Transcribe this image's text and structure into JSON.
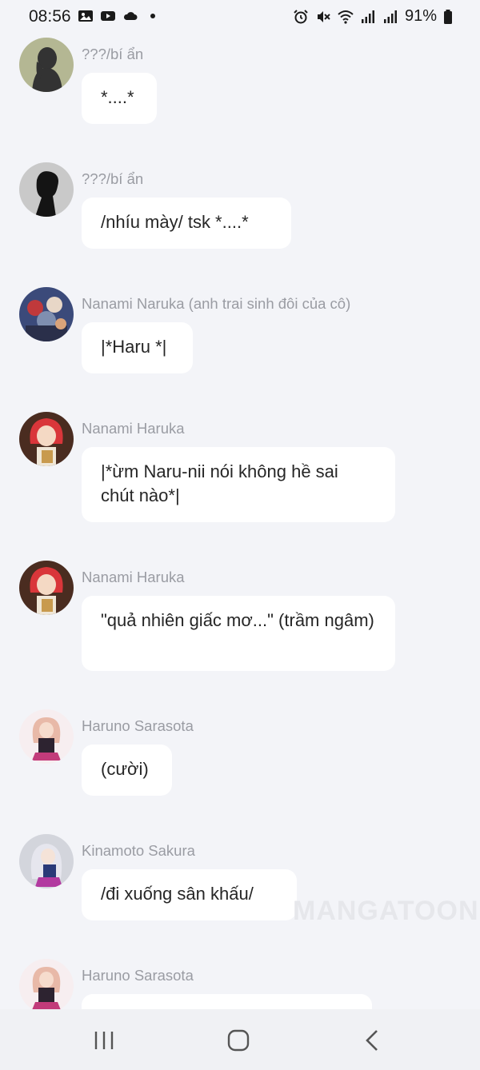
{
  "status_bar": {
    "time": "08:56",
    "left_icons": [
      "image-icon",
      "youtube-icon",
      "cloud-icon",
      "dot-icon"
    ],
    "right_icons": [
      "alarm-icon",
      "mute-icon",
      "wifi-icon",
      "signal-icon",
      "signal-icon",
      "battery-icon"
    ],
    "battery": "91%"
  },
  "messages": [
    {
      "name": "???/bí ẩn",
      "text": "*....*",
      "avatar": "silhouette-female-avatar"
    },
    {
      "name": "???/bí ẩn",
      "text": "/nhíu mày/ tsk *....*",
      "avatar": "silhouette-male-avatar"
    },
    {
      "name": "Nanami Naruka (anh trai sinh đôi của cô)",
      "text": "|*Haru *|",
      "avatar": "anime-group-avatar"
    },
    {
      "name": "Nanami Haruka",
      "text": "|*ừm Naru-nii nói không hề sai chút nào*|",
      "avatar": "red-hair-girl-avatar"
    },
    {
      "name": "Nanami Haruka",
      "text": "\"quả nhiên giấc mơ...\" (trầm ngâm)",
      "avatar": "red-hair-girl-avatar"
    },
    {
      "name": "Haruno Sarasota",
      "text": "(cười)",
      "avatar": "pink-hair-idol-avatar"
    },
    {
      "name": "Kinamoto Sakura",
      "text": "/đi xuống sân khấu/",
      "avatar": "silver-hair-idol-avatar"
    },
    {
      "name": "Haruno Sarasota",
      "text": "",
      "avatar": "pink-hair-idol-avatar"
    }
  ],
  "watermark": "MANGATOON",
  "nav_bar": {
    "buttons": [
      "recent-apps-icon",
      "home-icon",
      "back-icon"
    ]
  },
  "colors": {
    "background": "#f3f4f8",
    "bubble": "#ffffff",
    "name_text": "#9a9ca3",
    "message_text": "#262626"
  }
}
